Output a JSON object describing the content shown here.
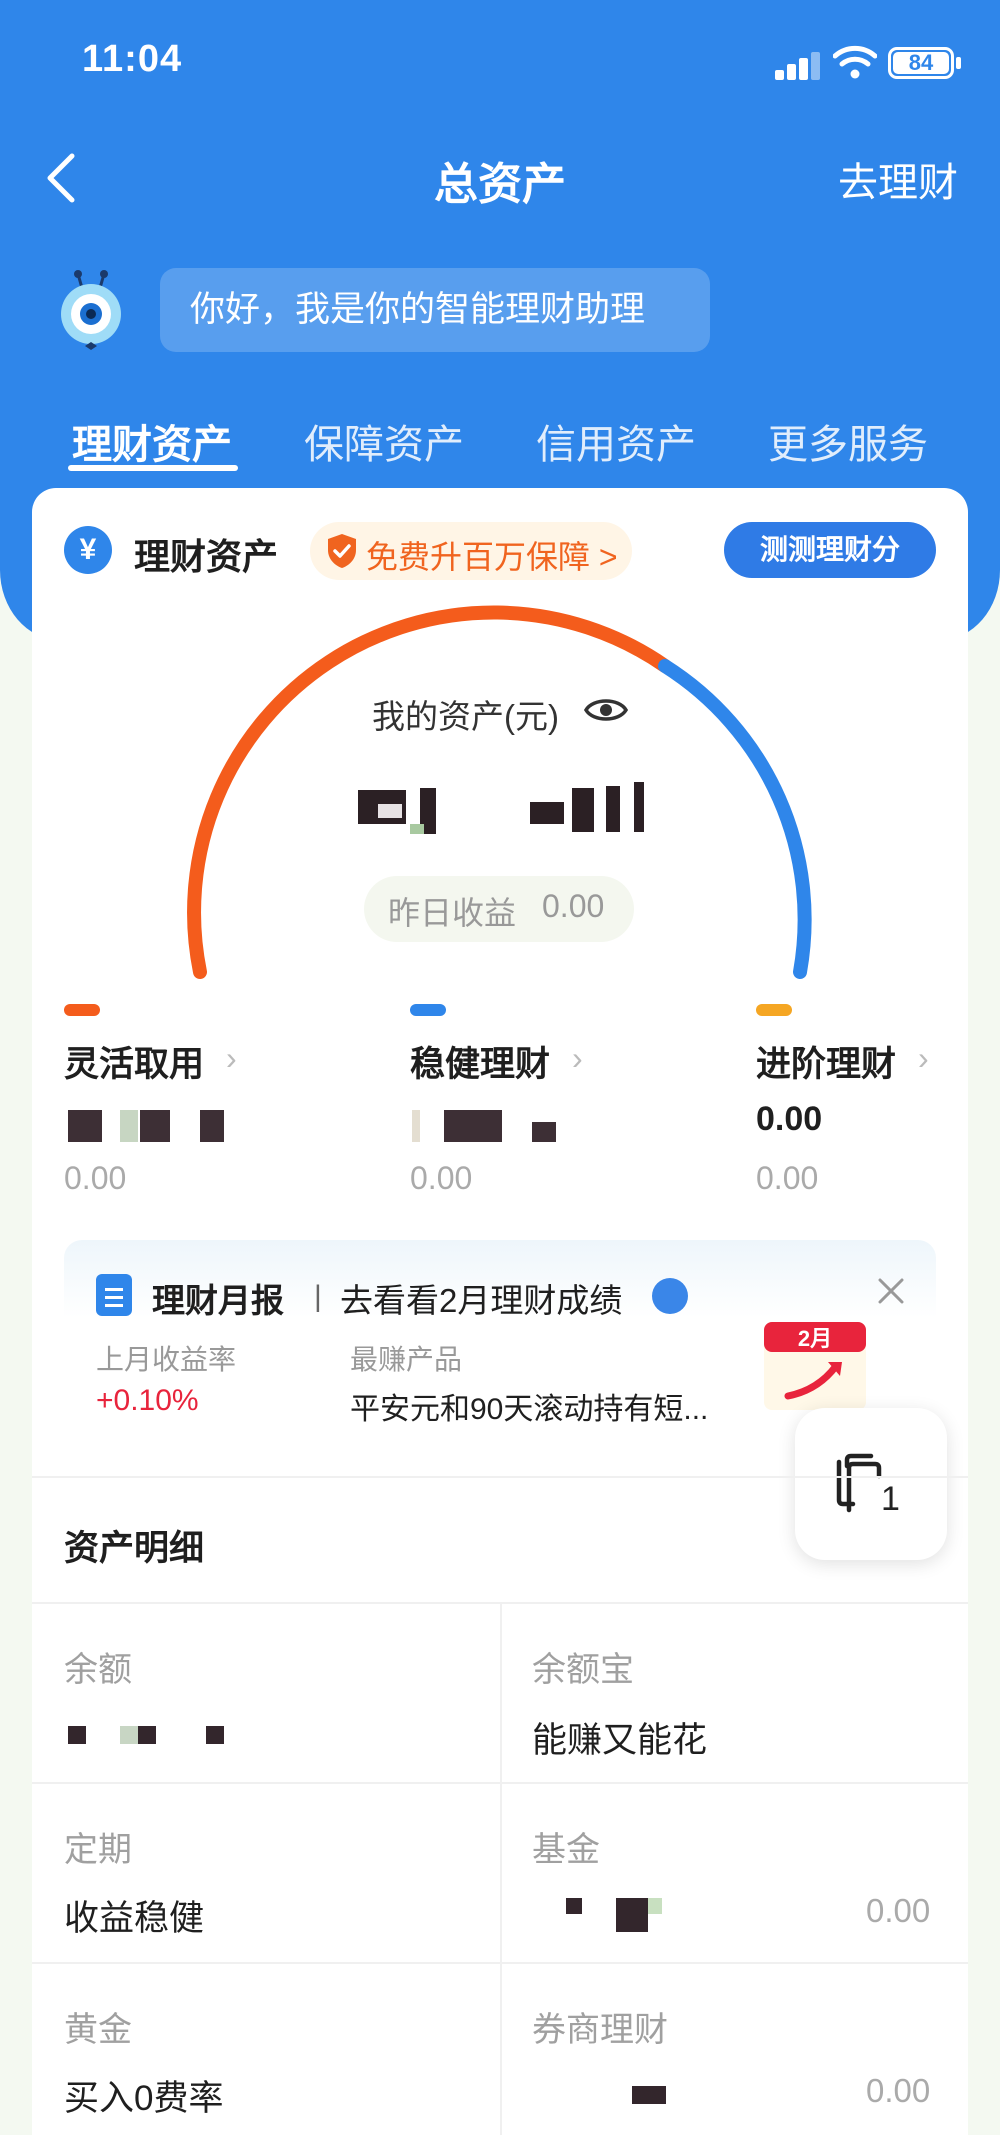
{
  "status_bar": {
    "time": "11:04",
    "battery": "84"
  },
  "nav": {
    "title": "总资产",
    "action": "去理财"
  },
  "assistant": {
    "greeting": "你好，我是你的智能理财助理"
  },
  "tabs": [
    "理财资产",
    "保障资产",
    "信用资产",
    "更多服务"
  ],
  "card": {
    "title": "理财资产",
    "currency_icon": "¥",
    "promo": "免费升百万保障 >",
    "score_button": "测测理财分",
    "asset_label": "我的资产(元)",
    "yesterday_label": "昨日收益",
    "yesterday_value": "0.00",
    "gauge_colors": {
      "flexible": "#f45c1c",
      "steady": "#2f86ea",
      "advanced": "#f5a623"
    }
  },
  "categories": [
    {
      "name": "灵活取用",
      "value": "",
      "sub": "0.00",
      "color": "#f45c1c"
    },
    {
      "name": "稳健理财",
      "value": "",
      "sub": "0.00",
      "color": "#2f86ea"
    },
    {
      "name": "进阶理财",
      "value": "0.00",
      "sub": "0.00",
      "color": "#f5a623"
    }
  ],
  "report": {
    "title": "理财月报",
    "divider": "|",
    "link": "去看看2月理财成绩",
    "last_month_label": "上月收益率",
    "last_month_value": "+0.10%",
    "top_product_label": "最赚产品",
    "top_product_value": "平安元和90天滚动持有短...",
    "calendar_month": "2月"
  },
  "float_button": {
    "count": "1"
  },
  "details": {
    "title": "资产明细",
    "cells": [
      {
        "label": "余额",
        "value": "",
        "amount": ""
      },
      {
        "label": "余额宝",
        "value": "能赚又能花",
        "amount": ""
      },
      {
        "label": "定期",
        "value": "收益稳健",
        "amount": ""
      },
      {
        "label": "基金",
        "value": "",
        "amount": "0.00"
      },
      {
        "label": "黄金",
        "value": "买入0费率",
        "amount": ""
      },
      {
        "label": "券商理财",
        "value": "",
        "amount": "0.00"
      }
    ]
  }
}
